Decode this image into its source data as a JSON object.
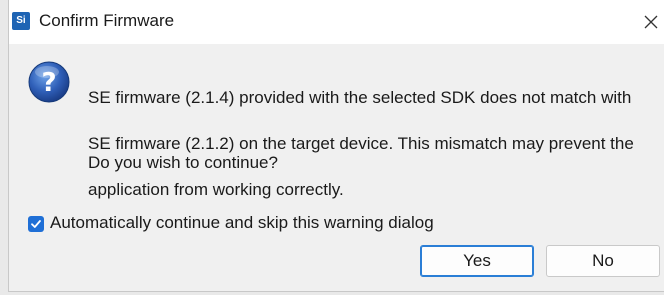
{
  "window": {
    "title": "Confirm Firmware",
    "app_icon_text": "Si",
    "app_icon_color": "#1e64b4"
  },
  "message": {
    "line1": "SE firmware (2.1.4) provided with the selected SDK does not match with",
    "line2": "SE firmware (2.1.2) on the target device. This mismatch may prevent the",
    "line3": "application from working correctly.",
    "question": "Do you wish to continue?",
    "icon": "question-icon"
  },
  "checkbox": {
    "label": "Automatically continue and skip this warning dialog",
    "checked": true,
    "color": "#1f6fd6"
  },
  "buttons": {
    "yes_label": "Yes",
    "no_label": "No",
    "default_accent": "#2a7ed6"
  }
}
